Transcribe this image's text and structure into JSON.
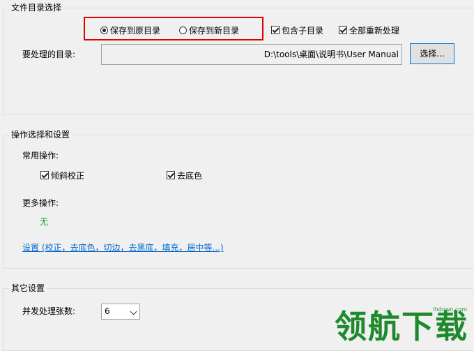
{
  "dir_group": {
    "title": "文件目录选择",
    "save_original": "保存到原目录",
    "save_new": "保存到新目录",
    "include_subdirs": "包含子目录",
    "reprocess_all": "全部重新处理",
    "dir_label": "要处理的目录:",
    "dir_value": "D:\\tools\\桌面\\说明书\\User Manual",
    "browse_button": "选择..."
  },
  "ops_group": {
    "title": "操作选择和设置",
    "common_label": "常用操作:",
    "deskew": "倾斜校正",
    "remove_bg": "去底色",
    "more_label": "更多操作:",
    "more_value": "无",
    "settings_link": "设置 (校正，去底色，切边，去黑底，填充，居中等...)"
  },
  "other_group": {
    "title": "其它设置",
    "concurrency_label": "并发处理张数:",
    "concurrency_value": "6"
  },
  "watermark": {
    "text": "领航下载",
    "url": "lhdown.com"
  },
  "colors": {
    "highlight": "#e00000",
    "green_text": "#13a313",
    "link": "#0066cc"
  }
}
